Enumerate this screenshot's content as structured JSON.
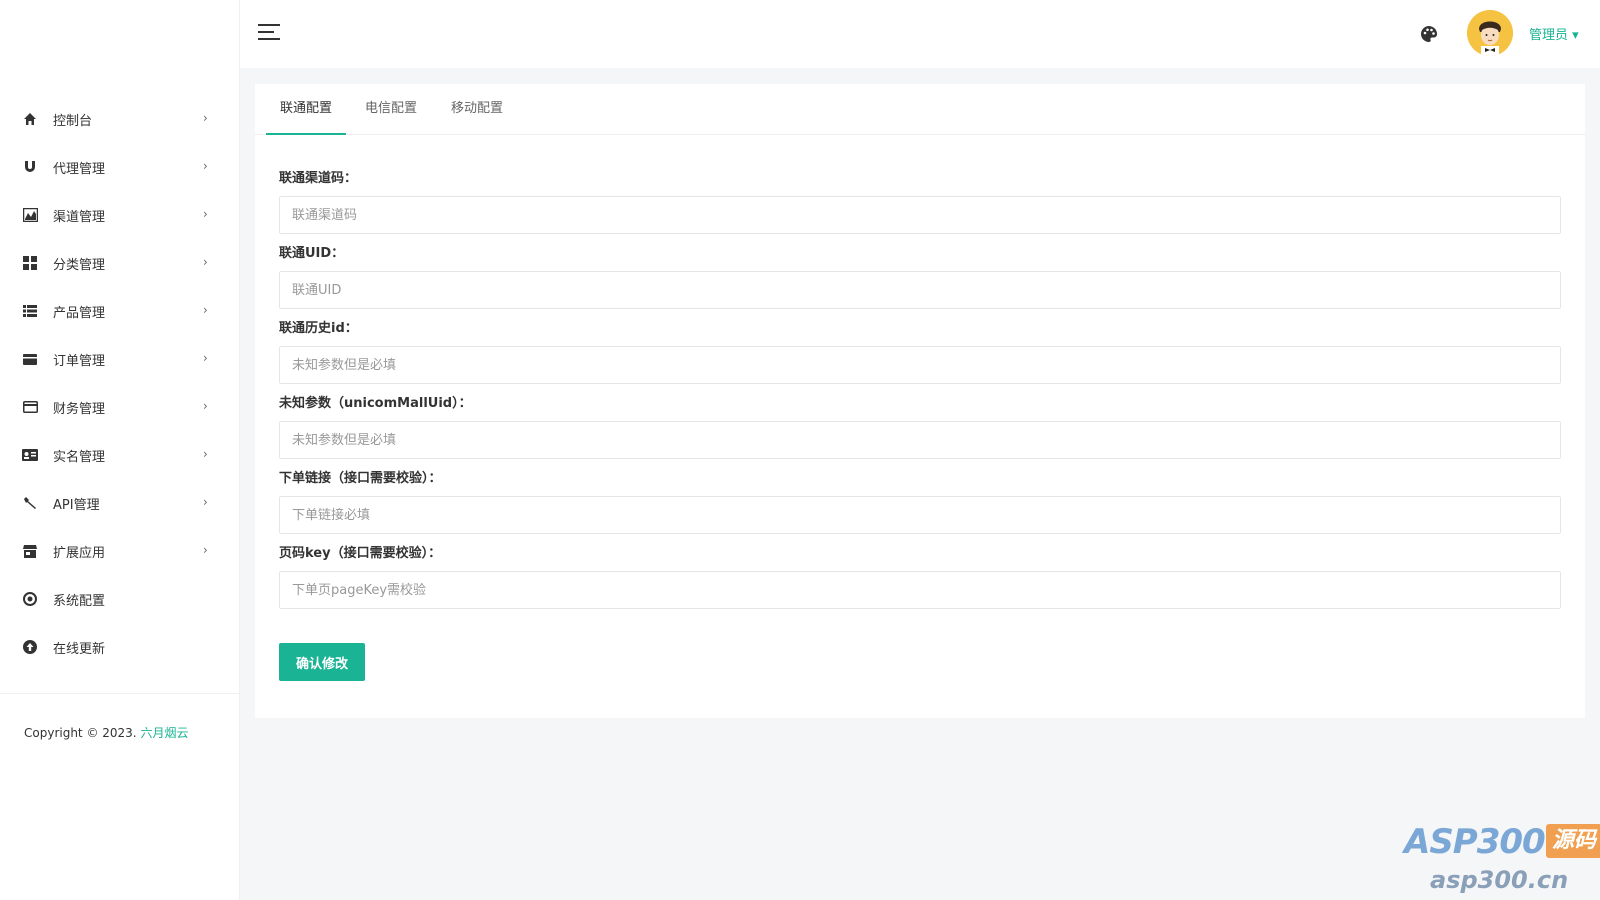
{
  "sidebar": {
    "items": [
      {
        "label": "控制台",
        "icon": "home-icon"
      },
      {
        "label": "代理管理",
        "icon": "magnet-icon"
      },
      {
        "label": "渠道管理",
        "icon": "chart-icon"
      },
      {
        "label": "分类管理",
        "icon": "grid-icon"
      },
      {
        "label": "产品管理",
        "icon": "list-icon"
      },
      {
        "label": "订单管理",
        "icon": "order-icon"
      },
      {
        "label": "财务管理",
        "icon": "credit-card-icon"
      },
      {
        "label": "实名管理",
        "icon": "id-card-icon"
      },
      {
        "label": "API管理",
        "icon": "wrench-icon"
      },
      {
        "label": "扩展应用",
        "icon": "store-icon"
      },
      {
        "label": "系统配置",
        "icon": "settings-icon"
      },
      {
        "label": "在线更新",
        "icon": "upload-icon"
      }
    ],
    "chevron": "›",
    "footer": {
      "copyright": "Copyright © 2023.",
      "brand": "六月烟云"
    }
  },
  "header": {
    "user_label": "管理员 ▾"
  },
  "tabs": [
    {
      "label": "联通配置",
      "active": true
    },
    {
      "label": "电信配置",
      "active": false
    },
    {
      "label": "移动配置",
      "active": false
    }
  ],
  "form": {
    "fields": [
      {
        "label": "联通渠道码：",
        "placeholder": "联通渠道码",
        "value": ""
      },
      {
        "label": "联通UID：",
        "placeholder": "联通UID",
        "value": ""
      },
      {
        "label": "联通历史id：",
        "placeholder": "未知参数但是必填",
        "value": ""
      },
      {
        "label": "未知参数（unicomMallUid）：",
        "placeholder": "未知参数但是必填",
        "value": ""
      },
      {
        "label": "下单链接（接口需要校验）：",
        "placeholder": "下单链接必填",
        "value": ""
      },
      {
        "label": "页码key（接口需要校验）：",
        "placeholder": "下单页pageKey需校验",
        "value": ""
      }
    ],
    "submit_label": "确认修改"
  },
  "watermark": {
    "text": "ASP300",
    "badge": "源码",
    "url": "asp300.cn"
  },
  "colors": {
    "accent": "#1ab394",
    "background": "#f5f6f8"
  }
}
